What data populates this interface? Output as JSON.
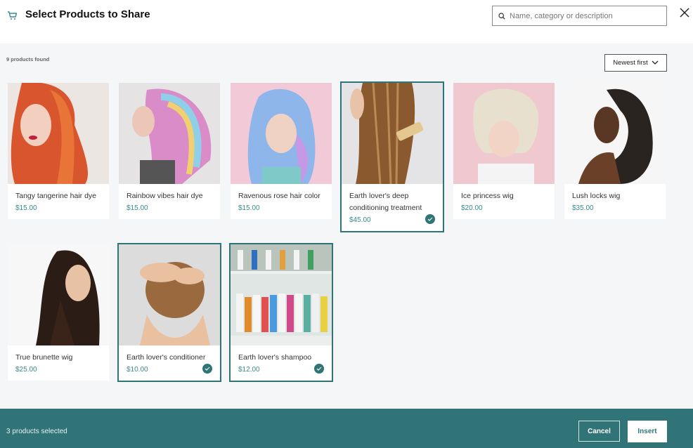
{
  "header": {
    "title": "Select Products to Share",
    "search_placeholder": "Name, category or description",
    "search_value": ""
  },
  "toolbar": {
    "results_count": "9 products found",
    "sort_selected": "Newest first"
  },
  "products": [
    {
      "name": "Tangy tangerine hair dye",
      "price": "$15.00",
      "selected": false,
      "image": "woman-with-orange-curly-hair"
    },
    {
      "name": "Rainbow vibes hair dye",
      "price": "$15.00",
      "selected": false,
      "image": "woman-with-rainbow-hair"
    },
    {
      "name": "Ravenous rose hair color",
      "price": "$15.00",
      "selected": false,
      "image": "woman-with-blue-lilac-hair"
    },
    {
      "name": "Earth lover's deep conditioning treatment",
      "price": "$45.00",
      "selected": true,
      "image": "woman-combing-long-brown-hair"
    },
    {
      "name": "Ice princess wig",
      "price": "$20.00",
      "selected": false,
      "image": "woman-with-platinum-blonde-bob"
    },
    {
      "name": "Lush locks wig",
      "price": "$35.00",
      "selected": false,
      "image": "woman-with-braids"
    },
    {
      "name": "True brunette wig",
      "price": "$25.00",
      "selected": false,
      "image": "woman-with-long-straight-brunette-hair"
    },
    {
      "name": "Earth lover's conditioner",
      "price": "$10.00",
      "selected": true,
      "image": "woman-washing-hair"
    },
    {
      "name": "Earth lover's shampoo",
      "price": "$12.00",
      "selected": true,
      "image": "shelves-of-shampoo-bottles"
    }
  ],
  "footer": {
    "selected_count": "3 products selected",
    "cancel_label": "Cancel",
    "insert_label": "Insert"
  },
  "colors": {
    "accent": "#307477",
    "price": "#3a8a8e",
    "background": "#f5f6f8"
  }
}
